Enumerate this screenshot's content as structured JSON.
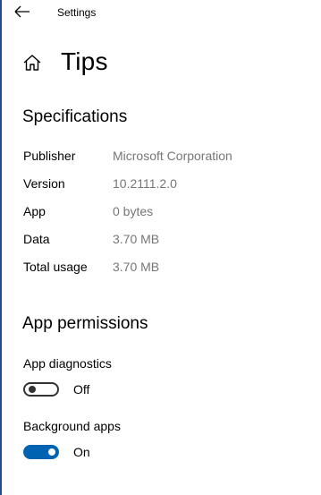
{
  "window": {
    "title": "Settings",
    "back_icon": "arrow-left-icon"
  },
  "page": {
    "title": "Tips",
    "home_icon": "home-icon"
  },
  "specifications": {
    "heading": "Specifications",
    "rows": [
      {
        "label": "Publisher",
        "value": "Microsoft Corporation"
      },
      {
        "label": "Version",
        "value": "10.2111.2.0"
      },
      {
        "label": "App",
        "value": "0 bytes"
      },
      {
        "label": "Data",
        "value": "3.70 MB"
      },
      {
        "label": "Total usage",
        "value": "3.70 MB"
      }
    ]
  },
  "permissions": {
    "heading": "App permissions",
    "items": [
      {
        "label": "App diagnostics",
        "state": "Off",
        "on": false
      },
      {
        "label": "Background apps",
        "state": "On",
        "on": true
      }
    ]
  },
  "colors": {
    "accent": "#0063b1",
    "secondary_text": "#767676",
    "left_edge": "#1f4e8c"
  }
}
